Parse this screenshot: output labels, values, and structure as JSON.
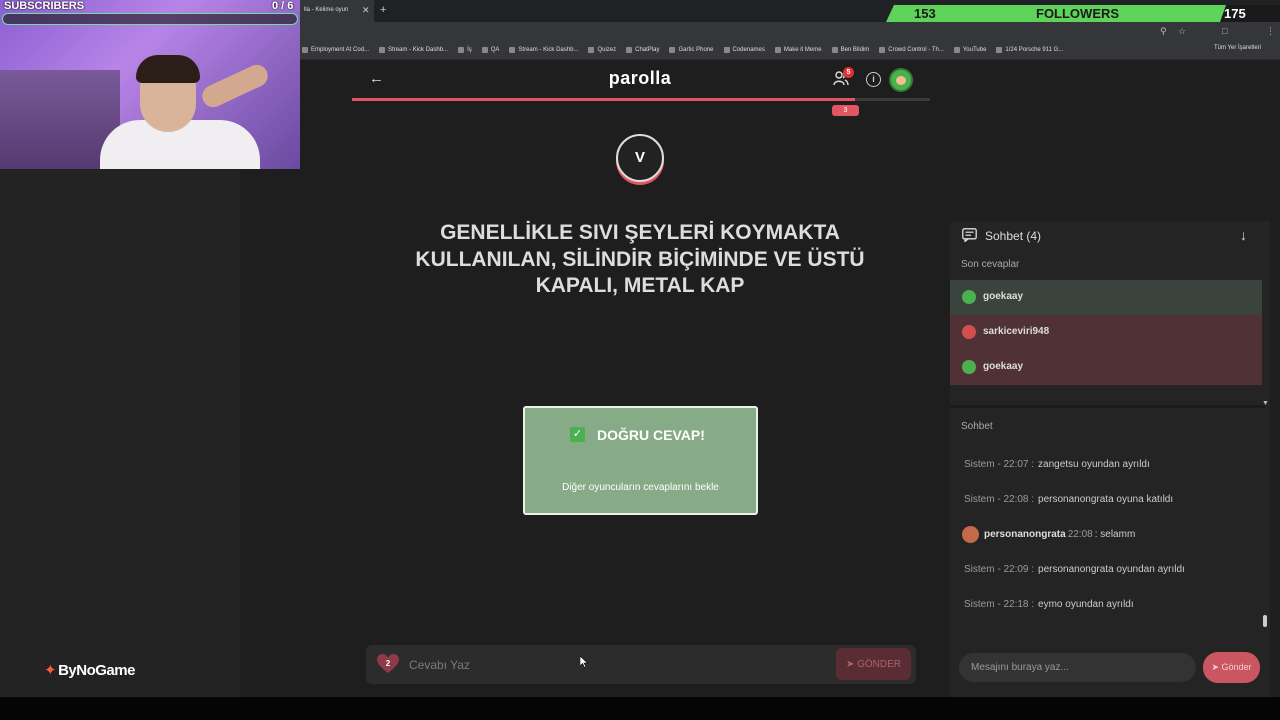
{
  "overlay": {
    "subscribers_label": "SUBSCRIBERS",
    "subscribers_count": "0 / 6",
    "followers_count": "153",
    "followers_label": "FOLLOWERS",
    "followers_goal": "175",
    "brand": "ByNoGame"
  },
  "browser": {
    "active_tab": "lla - Kelime oyun",
    "bookmarks": [
      "Employment At Cod...",
      "Stream - Kick Dashb...",
      "İş",
      "QA",
      "Stream - Kick Dashb...",
      "Quizez",
      "ChatPlay",
      "Gartic Phone",
      "Codenames",
      "Make it Meme",
      "Ben Bildim",
      "Crowd Control - Th...",
      "YouTube",
      "1/24 Porsche 911 G..."
    ],
    "bookmarks_right": "Tüm Yer İşaretleri"
  },
  "game": {
    "title": "parolla",
    "players_badge": "5",
    "info_glyph": "i",
    "progress_marker": "3",
    "progress": 0.87,
    "letter": "V",
    "question": "GENELLİKLE SIVI ŞEYLERİ KOYMAKTA KULLANILAN, SİLİNDİR BİÇİMİNDE VE ÜSTÜ KAPALI, METAL KAP",
    "result_title": "DOĞRU CEVAP!",
    "result_subtitle": "Diğer oyuncuların cevaplarını bekle",
    "lives": "2",
    "answer_placeholder": "Cevabı Yaz",
    "send_label": "GÖNDER"
  },
  "chat": {
    "title": "Sohbet (4)",
    "recent_label": "Son cevaplar",
    "recent_answers": [
      {
        "user": "goekaay",
        "status": "correct"
      },
      {
        "user": "sarkiceviri948",
        "status": "wrong"
      },
      {
        "user": "goekaay",
        "status": "wrong"
      }
    ],
    "section_label": "Sohbet",
    "messages": [
      {
        "meta": "Sistem - 22:07 :",
        "text": "zangetsu oyundan ayrıldı"
      },
      {
        "meta": "Sistem - 22:08 :",
        "text": "personanongrata oyuna katıldı"
      },
      {
        "user": "personanongrata",
        "time": "22:08",
        "text": ": selamm"
      },
      {
        "meta": "Sistem - 22:09 :",
        "text": "personanongrata oyundan ayrıldı"
      },
      {
        "meta": "Sistem - 22:18 :",
        "text": "eymo oyundan ayrıldı"
      }
    ],
    "input_placeholder": "Mesajını buraya yaz...",
    "send_label": "Gönder"
  },
  "colors": {
    "accent_red": "#e25563",
    "correct_green": "#86ab86",
    "followers_green": "#5ed35a"
  }
}
